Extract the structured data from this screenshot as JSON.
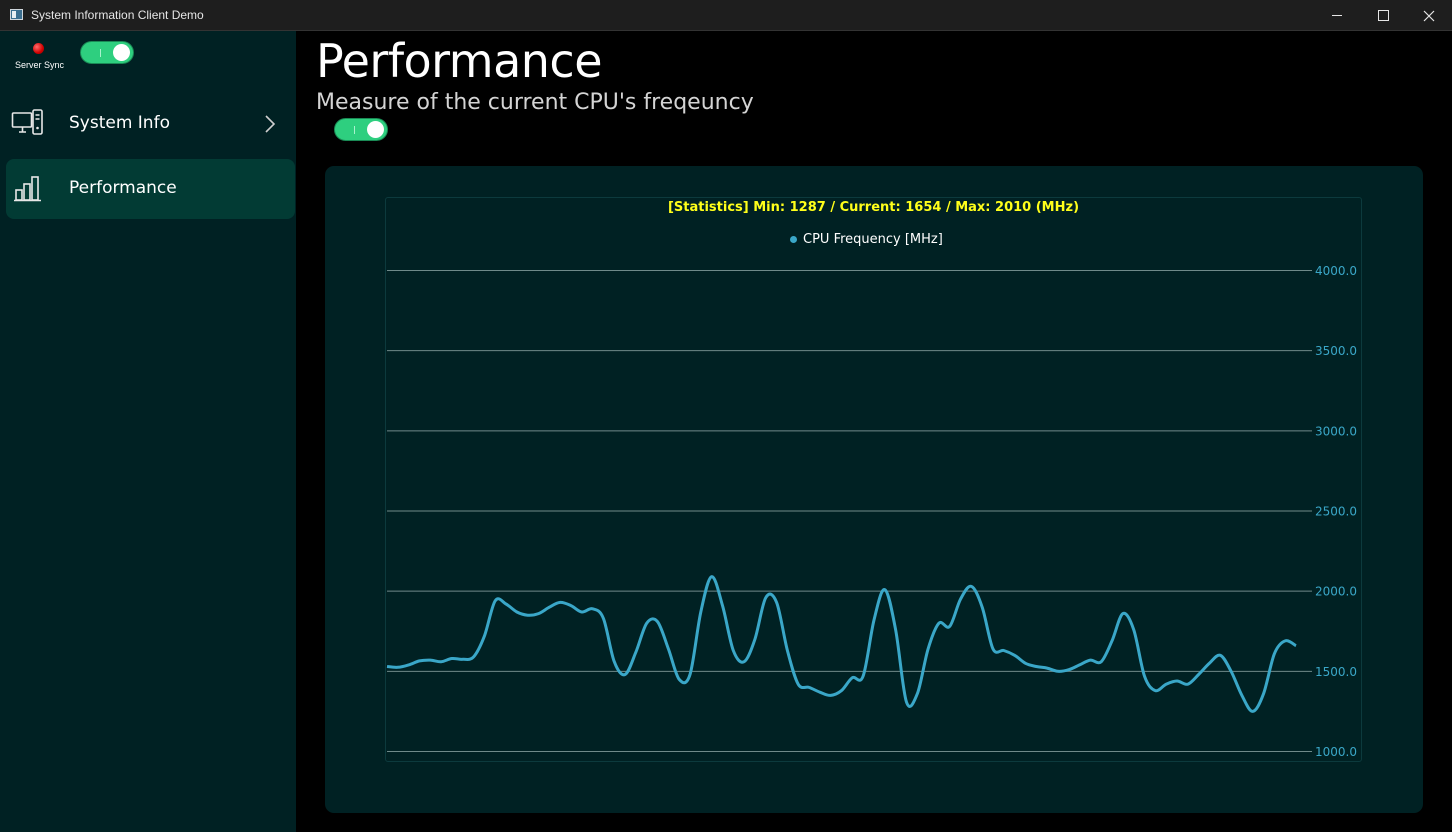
{
  "window": {
    "title": "System Information Client Demo"
  },
  "sidebar": {
    "sync_label": "Server Sync",
    "sync_status_color": "#d10000",
    "sync_toggle_on": true,
    "items": [
      {
        "label": "System Info",
        "icon": "desktop-computer-icon",
        "has_chevron": true,
        "selected": false
      },
      {
        "label": "Performance",
        "icon": "bar-chart-icon",
        "has_chevron": false,
        "selected": true
      }
    ]
  },
  "main": {
    "title": "Performance",
    "subtitle": "Measure of the current CPU's freqeuncy",
    "toggle_on": true
  },
  "colors": {
    "accent_toggle": "#2ecf7f",
    "series": "#3aa7c8",
    "stats_text": "#ffff1a",
    "card_bg": "#002123"
  },
  "chart_data": {
    "type": "line",
    "title": "[Statistics] Min: 1287 / Current: 1654 / Max: 2010 (MHz)",
    "legend_position": "top-center",
    "grid": true,
    "ylim": [
      1000,
      4000
    ],
    "y_ticks": [
      "4000.0",
      "3500.0",
      "3000.0",
      "2500.0",
      "2000.0",
      "1500.0",
      "1000.0"
    ],
    "y_axis_side": "right",
    "series": [
      {
        "name": "CPU Frequency [MHz]",
        "values": [
          1530,
          1525,
          1540,
          1565,
          1570,
          1560,
          1580,
          1575,
          1590,
          1720,
          1940,
          1920,
          1870,
          1850,
          1860,
          1900,
          1930,
          1910,
          1870,
          1890,
          1830,
          1560,
          1480,
          1620,
          1800,
          1810,
          1640,
          1450,
          1480,
          1870,
          2090,
          1910,
          1630,
          1560,
          1700,
          1960,
          1930,
          1630,
          1420,
          1400,
          1370,
          1350,
          1380,
          1460,
          1470,
          1820,
          2010,
          1760,
          1310,
          1360,
          1640,
          1800,
          1780,
          1950,
          2030,
          1900,
          1640,
          1630,
          1600,
          1550,
          1530,
          1520,
          1500,
          1510,
          1540,
          1570,
          1560,
          1690,
          1860,
          1760,
          1470,
          1380,
          1420,
          1440,
          1420,
          1480,
          1550,
          1600,
          1500,
          1350,
          1250,
          1360,
          1610,
          1690,
          1660
        ]
      }
    ]
  }
}
